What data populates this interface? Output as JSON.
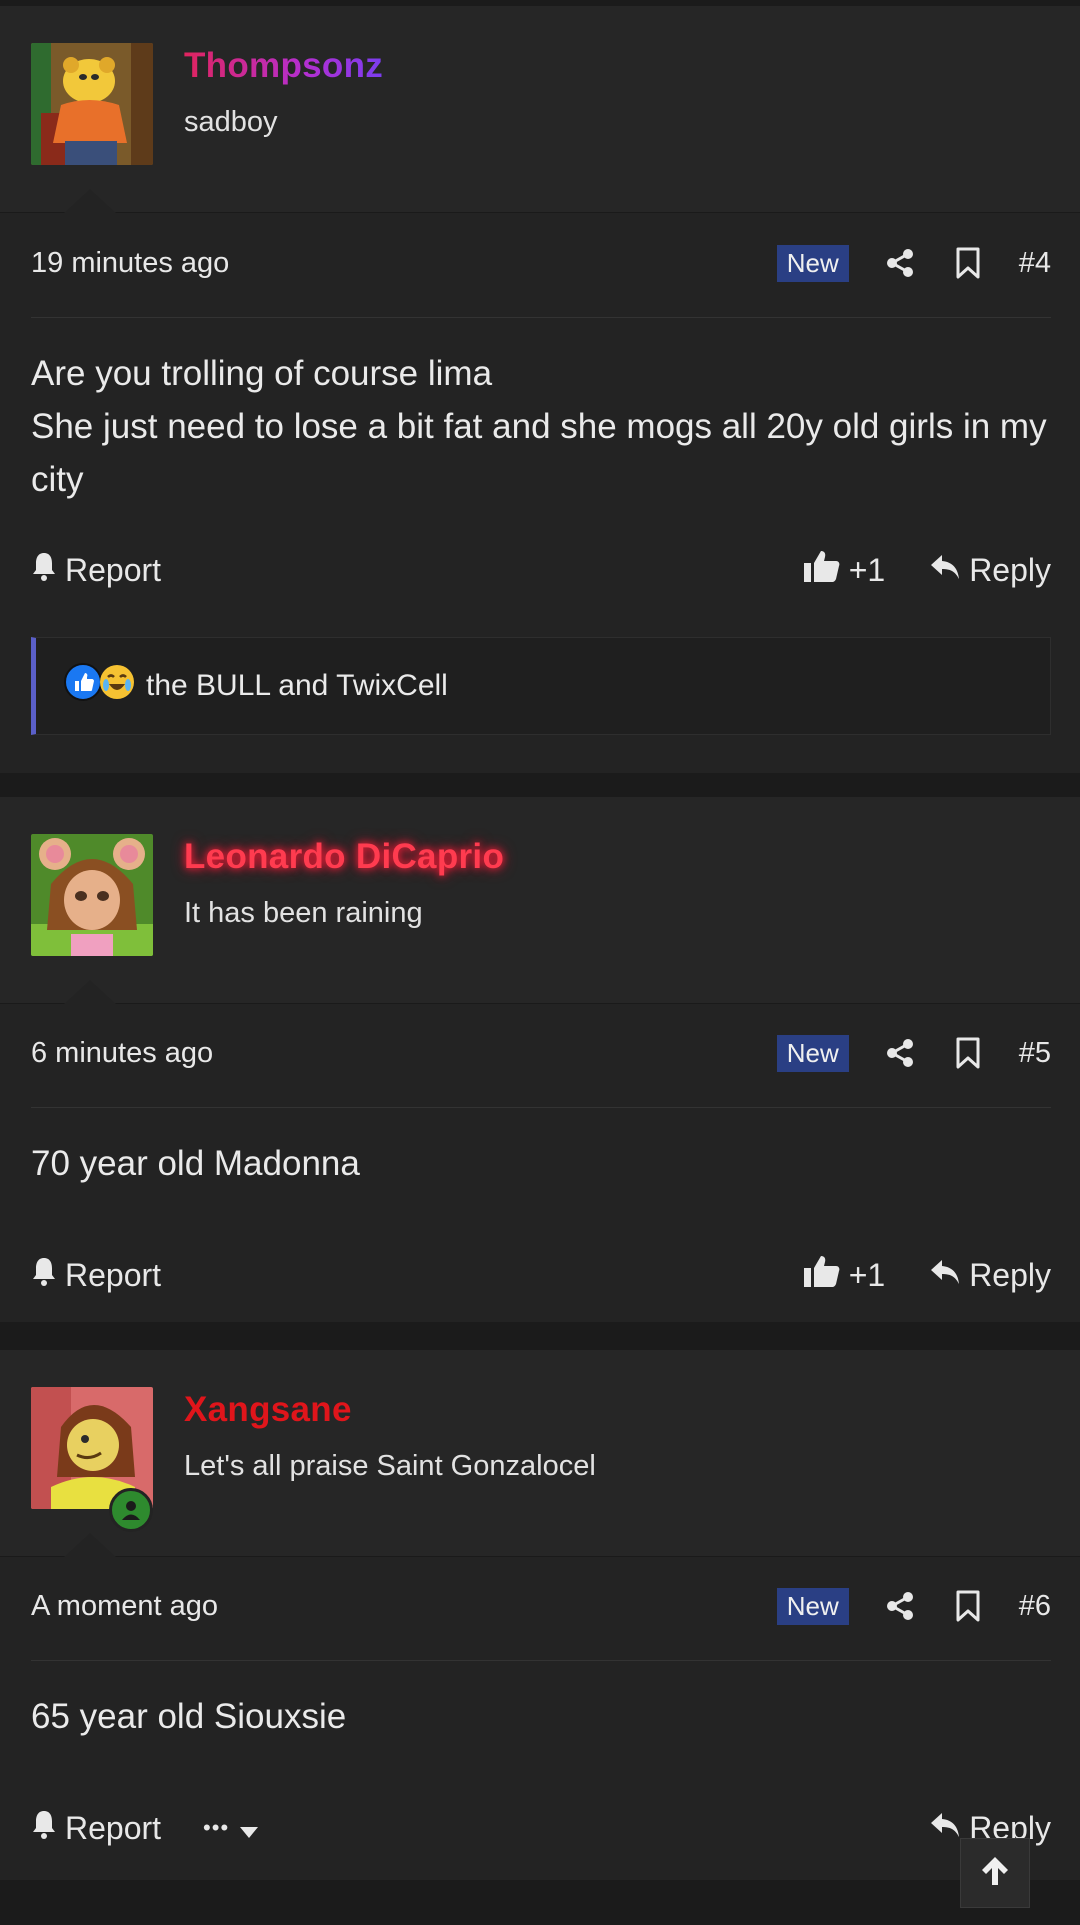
{
  "posts": [
    {
      "username": "Thompsonz",
      "user_title": "sadboy",
      "timestamp": "19 minutes ago",
      "badge": "New",
      "post_number": "#4",
      "body_lines": [
        "Are you trolling of course lima",
        "She just need to lose a bit fat and she mogs all 20y old girls in my city"
      ],
      "report_label": "Report",
      "like_count": "+1",
      "reply_label": "Reply",
      "reactions_text": "the BULL and TwixCell"
    },
    {
      "username": "Leonardo DiCaprio",
      "user_title": "It has been raining",
      "timestamp": "6 minutes ago",
      "badge": "New",
      "post_number": "#5",
      "body_lines": [
        "70 year old Madonna"
      ],
      "report_label": "Report",
      "like_count": "+1",
      "reply_label": "Reply"
    },
    {
      "username": "Xangsane",
      "user_title": "Let's all praise Saint Gonzalocel",
      "timestamp": "A moment ago",
      "badge": "New",
      "post_number": "#6",
      "body_lines": [
        "65 year old Siouxsie"
      ],
      "report_label": "Report",
      "more_label": "•••",
      "reply_label": "Reply"
    }
  ],
  "colors": {
    "background": "#1b1b1b",
    "post_bg": "#232323",
    "new_badge": "#2a3f84",
    "reaction_accent": "#5a5fc8",
    "username_thompsonz": "#c02f9a",
    "username_leo": "#ff3b4f",
    "username_xang": "#e0151b"
  },
  "icons": [
    "share-icon",
    "bookmark-icon",
    "bell-icon",
    "thumbs-up-icon",
    "reply-icon",
    "like-reaction-icon",
    "crying-laugh-reaction-icon",
    "online-status-icon",
    "chevron-down-icon",
    "arrow-up-icon"
  ]
}
